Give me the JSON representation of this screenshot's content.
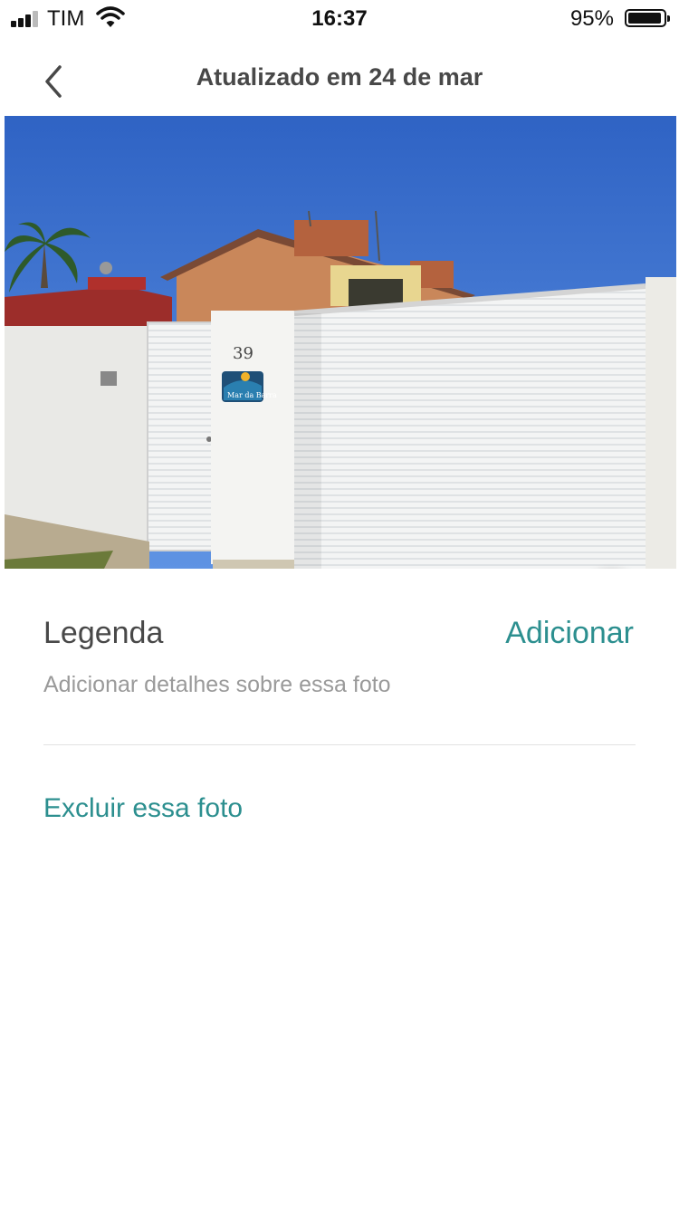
{
  "status_bar": {
    "carrier": "TIM",
    "time": "16:37",
    "battery": "95%"
  },
  "header": {
    "title": "Atualizado em 24 de mar",
    "back_icon": "chevron-left-icon"
  },
  "photo": {
    "sign_number": "39",
    "sign_text": "Mar da Barra",
    "edit_icon": "pencil-icon"
  },
  "caption": {
    "label": "Legenda",
    "add_label": "Adicionar",
    "placeholder": "Adicionar detalhes sobre essa foto"
  },
  "actions": {
    "delete_label": "Excluir essa foto"
  },
  "colors": {
    "accent": "#2c8f8f",
    "text": "#484848",
    "muted": "#9a9a9a"
  }
}
